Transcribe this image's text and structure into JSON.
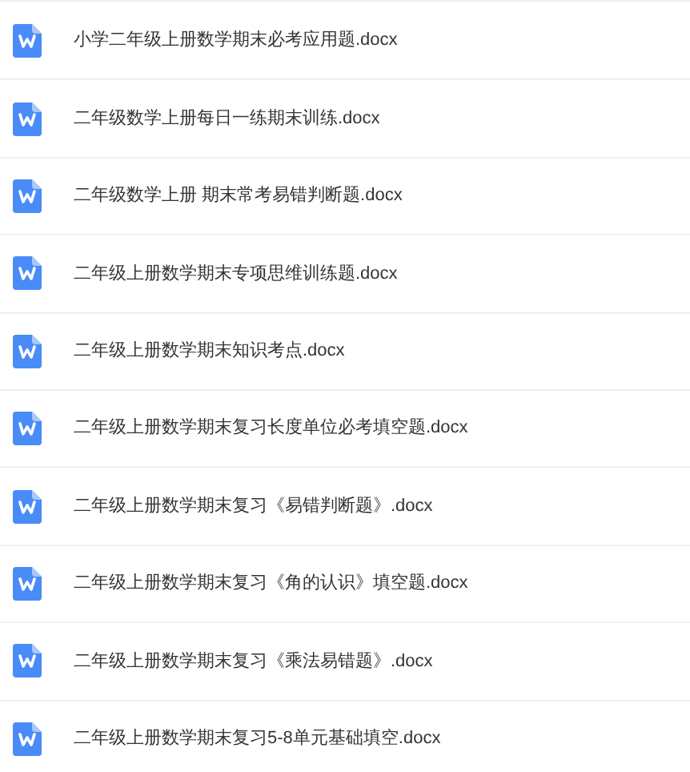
{
  "files": [
    {
      "name": "小学二年级上册数学期末必考应用题.docx",
      "kind": "word"
    },
    {
      "name": "二年级数学上册每日一练期末训练.docx",
      "kind": "word"
    },
    {
      "name": "二年级数学上册 期末常考易错判断题.docx",
      "kind": "word"
    },
    {
      "name": "二年级上册数学期末专项思维训练题.docx",
      "kind": "word"
    },
    {
      "name": "二年级上册数学期末知识考点.docx",
      "kind": "word"
    },
    {
      "name": "二年级上册数学期末复习长度单位必考填空题.docx",
      "kind": "word"
    },
    {
      "name": "二年级上册数学期末复习《易错判断题》.docx",
      "kind": "word"
    },
    {
      "name": "二年级上册数学期末复习《角的认识》填空题.docx",
      "kind": "word"
    },
    {
      "name": "二年级上册数学期末复习《乘法易错题》.docx",
      "kind": "word"
    },
    {
      "name": "二年级上册数学期末复习5-8单元基础填空.docx",
      "kind": "word"
    }
  ]
}
